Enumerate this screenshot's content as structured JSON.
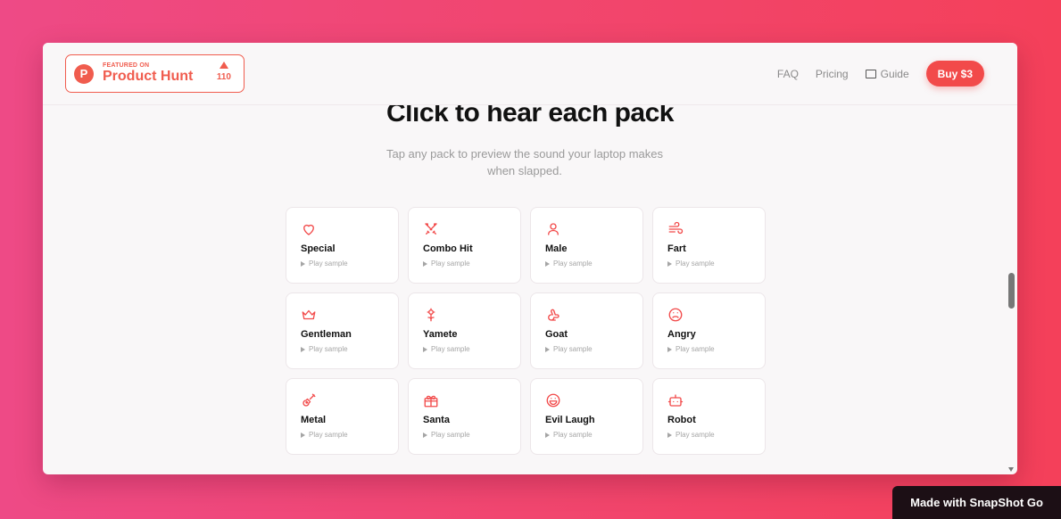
{
  "product_hunt": {
    "featured_label": "FEATURED ON",
    "brand": "Product Hunt",
    "logo_letter": "P",
    "votes": "110"
  },
  "nav": {
    "faq": "FAQ",
    "pricing": "Pricing",
    "guide": "Guide",
    "buy": "Buy $3"
  },
  "hero": {
    "title": "Click to hear each pack",
    "subtitle": "Tap any pack to preview the sound your laptop makes when slapped."
  },
  "play_label": "Play sample",
  "packs": [
    {
      "name": "Special",
      "icon": "heart-icon"
    },
    {
      "name": "Combo Hit",
      "icon": "crossed-swords-icon"
    },
    {
      "name": "Male",
      "icon": "user-icon"
    },
    {
      "name": "Fart",
      "icon": "wind-icon"
    },
    {
      "name": "Gentleman",
      "icon": "crown-icon"
    },
    {
      "name": "Yamete",
      "icon": "flower-icon"
    },
    {
      "name": "Goat",
      "icon": "rabbit-icon"
    },
    {
      "name": "Angry",
      "icon": "frown-icon"
    },
    {
      "name": "Metal",
      "icon": "guitar-icon"
    },
    {
      "name": "Santa",
      "icon": "gift-icon"
    },
    {
      "name": "Evil Laugh",
      "icon": "laugh-icon"
    },
    {
      "name": "Robot",
      "icon": "bot-icon"
    }
  ],
  "footer_badge": "Made with SnapShot Go",
  "colors": {
    "accent": "#f24a4a",
    "product_hunt": "#f05c4e",
    "background_gradient_start": "#ee4a86",
    "background_gradient_end": "#f4405a"
  }
}
